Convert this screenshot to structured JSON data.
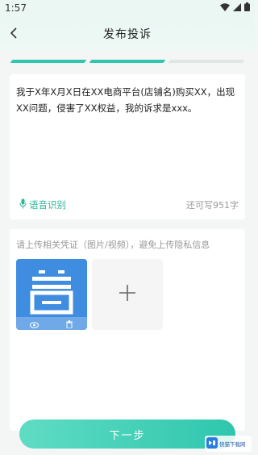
{
  "status_bar": {
    "time": "1:57"
  },
  "app_bar": {
    "title": "发布投诉"
  },
  "progress": {
    "steps_total": 3,
    "current_step": 2,
    "active_color": "#2fc6ae",
    "inactive_color": "#dfe6e4"
  },
  "complaint": {
    "text": "我于X年X月X日在XX电商平台(店铺名)购买XX，出现XX问题，侵害了XX权益，我的诉求是xxx。",
    "voice_label": "语音识别",
    "remaining": "还可写951字"
  },
  "upload": {
    "hint": "请上传相关凭证（图片/视频），避免上传隐私信息"
  },
  "actions": {
    "next_label": "下一步"
  },
  "watermark": {
    "text": "快猫下载网"
  },
  "colors": {
    "accent": "#2fc6ae",
    "thumbnail": "#3f8de0"
  }
}
